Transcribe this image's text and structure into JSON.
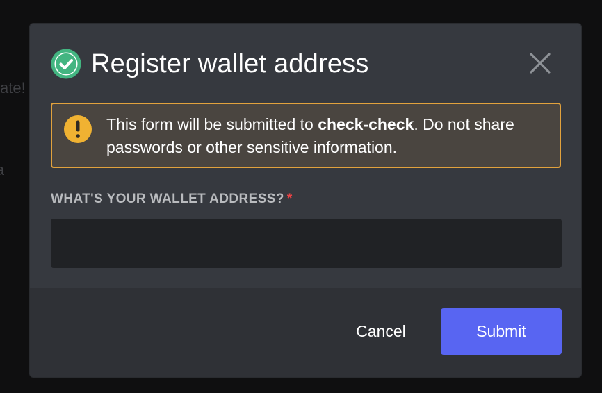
{
  "backdrop": {
    "fragment_1": "ate!",
    "fragment_2": "a"
  },
  "modal": {
    "title": "Register wallet address",
    "title_icon": "check-circle-icon",
    "close_icon": "close-icon"
  },
  "notice": {
    "icon": "warning-icon",
    "text_before": "This form will be submitted to ",
    "app_name": "check-check",
    "text_after": ". Do not share passwords or other sensitive information."
  },
  "field": {
    "label": "WHAT'S YOUR WALLET ADDRESS?",
    "required_marker": "*",
    "value": ""
  },
  "footer": {
    "cancel_label": "Cancel",
    "submit_label": "Submit"
  },
  "colors": {
    "accent": "#5865f2",
    "success": "#43b581",
    "warning": "#f0b232",
    "danger": "#ed4245"
  }
}
